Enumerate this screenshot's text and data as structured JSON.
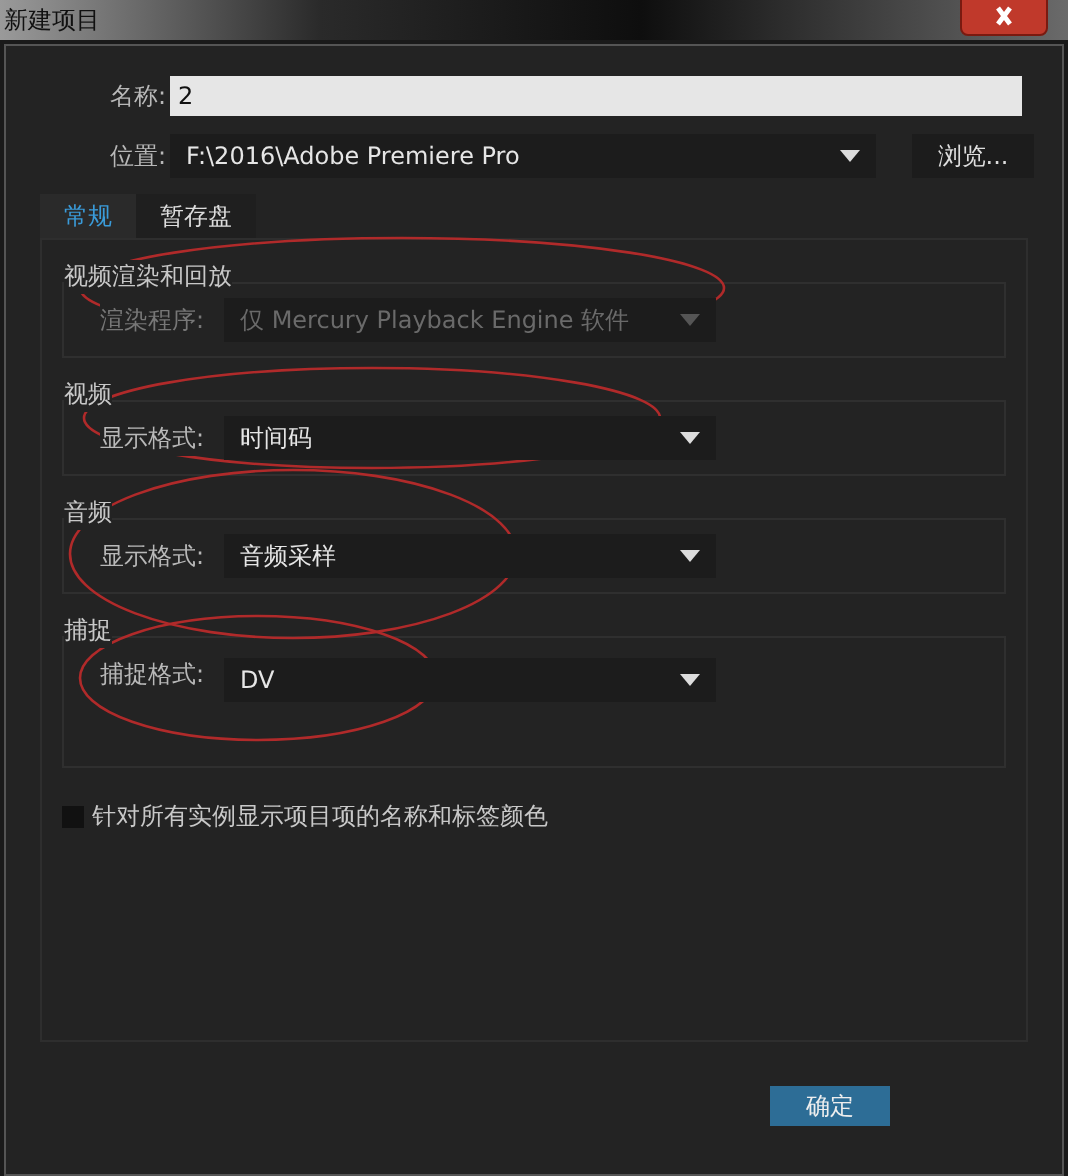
{
  "window": {
    "title": "新建项目"
  },
  "name_field": {
    "label": "名称:",
    "value": "2"
  },
  "location": {
    "label": "位置:",
    "value": "F:\\2016\\Adobe Premiere Pro",
    "browse_button": "浏览..."
  },
  "tabs": [
    {
      "label": "常规",
      "selected": true
    },
    {
      "label": "暂存盘",
      "selected": false
    }
  ],
  "groups": [
    {
      "title": "视频渲染和回放",
      "field_label": "渲染程序:",
      "value": "仅 Mercury Playback Engine 软件",
      "disabled": true,
      "highlighted": true
    },
    {
      "title": "视频",
      "field_label": "显示格式:",
      "value": "时间码",
      "disabled": false,
      "highlighted": true
    },
    {
      "title": "音频",
      "field_label": "显示格式:",
      "value": "音频采样",
      "disabled": false,
      "highlighted": true
    },
    {
      "title": "捕捉",
      "field_label": "捕捉格式:",
      "value": "DV",
      "disabled": false,
      "highlighted": true
    }
  ],
  "checkbox": {
    "label": "针对所有实例显示项目项的名称和标签颜色",
    "checked": false
  },
  "buttons": [
    "确定"
  ]
}
